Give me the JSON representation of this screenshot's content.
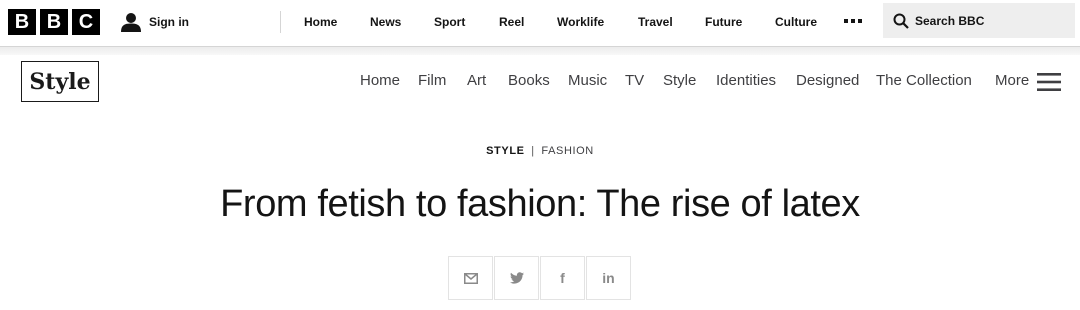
{
  "brand": {
    "letters": [
      "B",
      "B",
      "C"
    ]
  },
  "account": {
    "signin_label": "Sign in",
    "icon": "person-icon"
  },
  "top_nav": [
    "Home",
    "News",
    "Sport",
    "Reel",
    "Worklife",
    "Travel",
    "Future",
    "Culture"
  ],
  "more_icon": "ellipsis-icon",
  "search": {
    "label": "Search BBC",
    "icon": "search-icon"
  },
  "section": {
    "logo": "Style"
  },
  "section_nav": [
    "Home",
    "Film",
    "Art",
    "Books",
    "Music",
    "TV",
    "Style",
    "Identities",
    "Designed",
    "The Collection"
  ],
  "section_more": {
    "label": "More",
    "icon": "hamburger-menu-icon"
  },
  "article": {
    "section": "STYLE",
    "separator": "|",
    "subsection": "FASHION",
    "title": "From fetish to fashion: The rise of latex"
  },
  "share": [
    "email-icon",
    "twitter-icon",
    "facebook-icon",
    "linkedin-icon"
  ],
  "share_glyphs": {
    "facebook": "f",
    "linkedin": "in"
  },
  "colors": {
    "search_bg": "#eeeeee",
    "logo_bg": "#000000",
    "text": "#141414",
    "subnav_text": "#3f3f42"
  }
}
